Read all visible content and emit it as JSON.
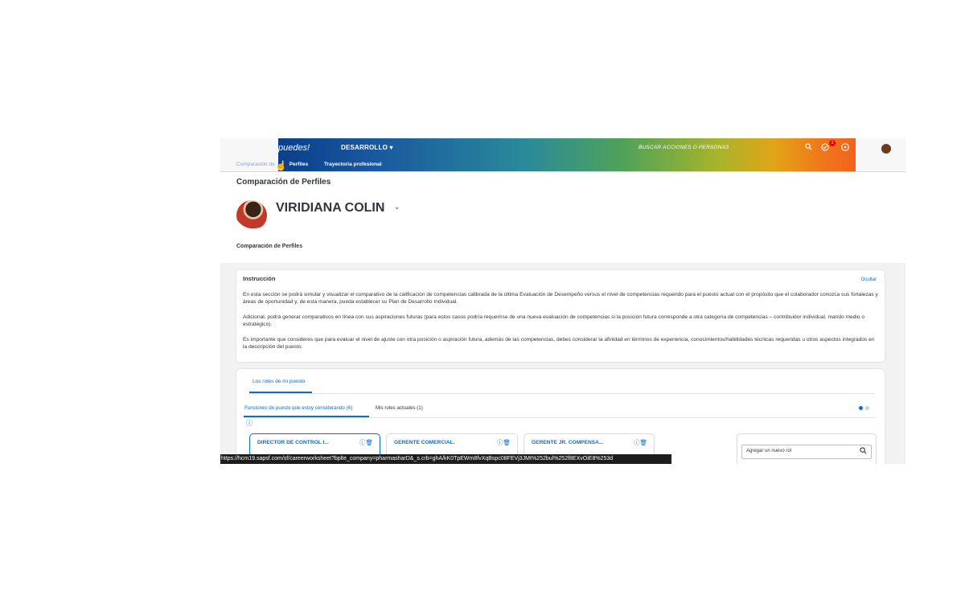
{
  "header": {
    "logo_text": "puedes!",
    "section_menu": "DESARROLLO",
    "section_menu_chevron": "▾",
    "search_label": "BUSCAR ACCIONES O PERSONAS",
    "notification_count": "3",
    "icons": [
      "search-icon",
      "notification-icon",
      "help-icon",
      "user-avatar"
    ]
  },
  "subnav": {
    "items": [
      "Comparación de",
      "Perfiles",
      "Trayectoria profesional"
    ]
  },
  "page": {
    "title": "Comparación de Perfiles",
    "person_name": "VIRIDIANA COLIN",
    "person_chevron": "⌄",
    "section_subtitle": "Comparación de Perfiles"
  },
  "instruction": {
    "title": "Instrucción",
    "hide_link": "Ocultar",
    "paragraphs": [
      "En esta sección se podrá simular y visualizar el comparativo de la calificación de competencias calibrada de la última Evaluación de Desempeño versus el nivel de competencias requerido para el puesto actual con el propósito que el colaborador conozca sus fortalezas y áreas de oportunidad y, de esta manera, pueda establecer su Plan de Desarrollo Individual.",
      "Adicional, podrá generar comparativos en línea con sus aspiraciones futuras (para estos casos podría requerirse de una nueva evaluación de competencias si la posición futura corresponde a otra categoría de competencias – contribuidor individual, mando medio o estratégico).",
      "Es importante que consideres que para evaluar el nivel de ajuste con otra posición o aspiración futura, además de las competencias, debes considerar la afinidad en términos de experiencia, conocimientos/habilidades técnicas requeridas u otros aspectos integrados en la descripción del puesto."
    ]
  },
  "roles": {
    "tab_label": "Los roles de mi puesto",
    "subtabs": [
      "Funciones de puesto que estoy considerando (6)",
      "Mis roles actuales (1)"
    ],
    "cards": [
      {
        "title": "DIRECTOR DE CONTROL I..."
      },
      {
        "title": "GERENTE COMERCIAL."
      },
      {
        "title": "GERENTE JR. COMPENSA..."
      }
    ],
    "add_placeholder": "Agregar un nuevo rol",
    "colors": {
      "accent": "#0a6ed1",
      "dot_active": "#0a6ed1",
      "dot_inactive": "#cfcfcf"
    }
  },
  "status_bar": {
    "url": "https://hcm19.sapsf.com/sf/careerworksheet?bplte_company=pharmasharD&_s.crb=ghA/kK0TpEWm8fvXqBspc08FEVj3JMt%252bul%252f8EXvOiE8%253d"
  }
}
